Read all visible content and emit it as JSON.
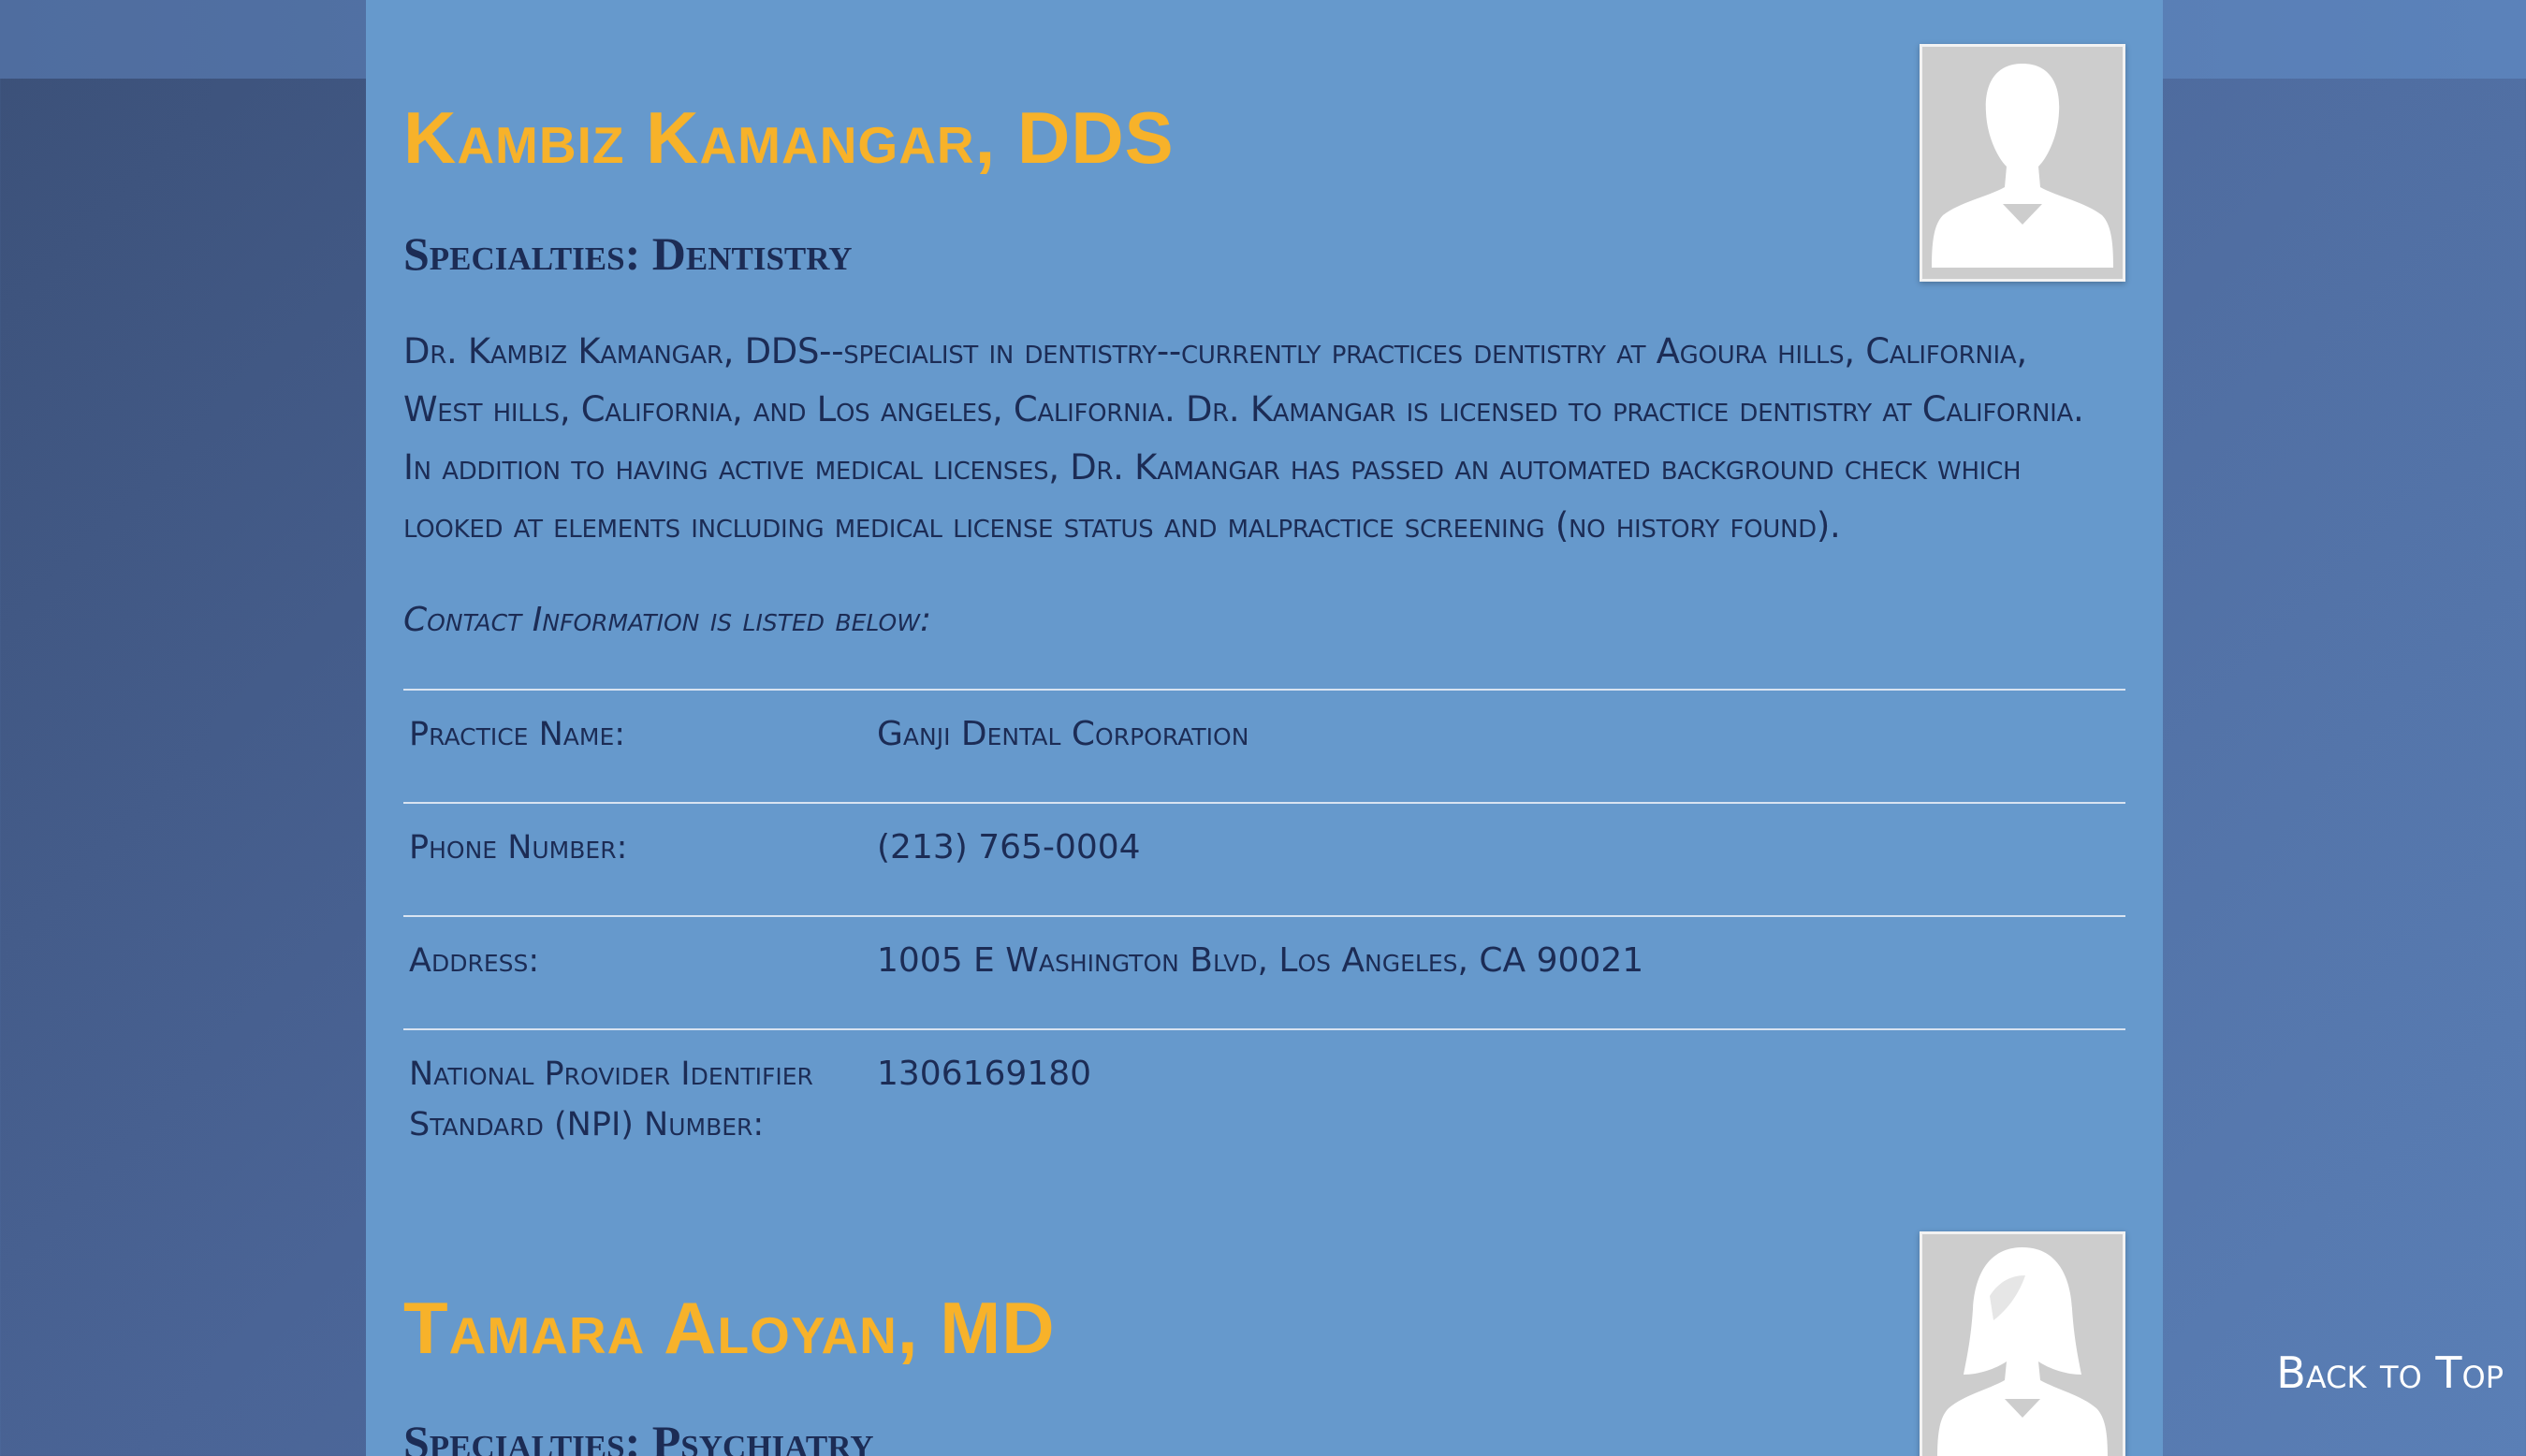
{
  "doctors": [
    {
      "name": "Kambiz Kamangar, DDS",
      "specialty": "Specialties: Dentistry",
      "avatar_icon": "male-silhouette-icon",
      "bio": "Dr. Kambiz Kamangar, DDS--specialist in dentistry--currently practices dentistry at Agoura hills, California, West hills, California, and Los angeles, California. Dr. Kamangar is licensed to practice dentistry at California. In addition to having active medical licenses, Dr. Kamangar has passed an automated background check which looked at elements including medical license status and malpractice screening (no history found).",
      "contact_note": "Contact Information is listed below:",
      "contact": {
        "practice_label": "Practice Name:",
        "practice_value": "Ganji Dental Corporation",
        "phone_label": "Phone Number:",
        "phone_value": "(213) 765-0004",
        "address_label": "Address:",
        "address_value": "1005 E Washington Blvd, Los Angeles, CA 90021",
        "npi_label": "National Provider Identifier Standard (NPI) Number:",
        "npi_value": "1306169180"
      }
    },
    {
      "name": "Tamara Aloyan, MD",
      "specialty": "Specialties: Psychiatry",
      "avatar_icon": "female-silhouette-icon"
    }
  ],
  "back_to_top": "Back to Top",
  "colors": {
    "panel": "#6699cc",
    "name": "#f7b22a",
    "text": "#1c2c55",
    "divider": "#d8e3f1"
  }
}
